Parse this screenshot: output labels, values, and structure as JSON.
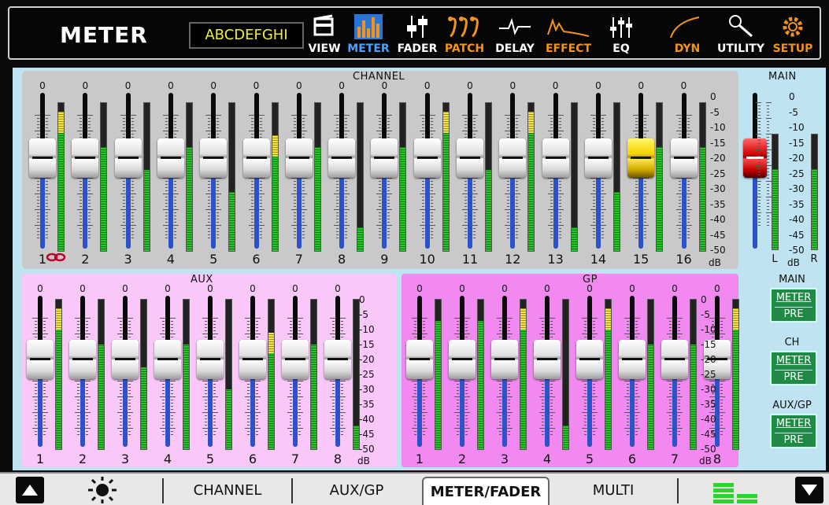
{
  "header": {
    "title": "METER",
    "scene_name": "ABCDEFGHI",
    "nav": [
      {
        "label": "VIEW",
        "icon": "view-icon",
        "color": "white",
        "active": false
      },
      {
        "label": "METER",
        "icon": "meter-icon",
        "color": "blue",
        "active": true
      },
      {
        "label": "FADER",
        "icon": "fader-icon",
        "color": "white",
        "active": false
      },
      {
        "label": "PATCH",
        "icon": "patch-icon",
        "color": "orange",
        "active": false
      },
      {
        "label": "DELAY",
        "icon": "delay-icon",
        "color": "white",
        "active": false
      },
      {
        "label": "EFFECT",
        "icon": "effect-icon",
        "color": "orange",
        "active": false
      },
      {
        "label": "EQ",
        "icon": "eq-icon",
        "color": "white",
        "active": false
      },
      {
        "label": "DYN",
        "icon": "dyn-icon",
        "color": "orange",
        "active": false
      },
      {
        "label": "UTILITY",
        "icon": "utility-icon",
        "color": "white",
        "active": false
      },
      {
        "label": "SETUP",
        "icon": "setup-icon",
        "color": "orange",
        "active": false
      }
    ]
  },
  "channel_section": {
    "title": "CHANNEL",
    "scale_unit": "dB",
    "scale": [
      "0",
      "-5",
      "-10",
      "-15",
      "-20",
      "-25",
      "-30",
      "-35",
      "-40",
      "-45",
      "-50"
    ],
    "strips": [
      {
        "number": "1",
        "gain": "0",
        "fader": 0.58,
        "meter": 0.94,
        "meter_peak": true,
        "knob": "white"
      },
      {
        "number": "2",
        "gain": "0",
        "fader": 0.58,
        "meter": 0.7,
        "meter_peak": false,
        "knob": "white"
      },
      {
        "number": "3",
        "gain": "0",
        "fader": 0.58,
        "meter": 0.55,
        "meter_peak": false,
        "knob": "white"
      },
      {
        "number": "4",
        "gain": "0",
        "fader": 0.58,
        "meter": 0.7,
        "meter_peak": false,
        "knob": "white"
      },
      {
        "number": "5",
        "gain": "0",
        "fader": 0.58,
        "meter": 0.4,
        "meter_peak": false,
        "knob": "white"
      },
      {
        "number": "6",
        "gain": "0",
        "fader": 0.58,
        "meter": 0.78,
        "meter_peak": true,
        "knob": "white"
      },
      {
        "number": "7",
        "gain": "0",
        "fader": 0.58,
        "meter": 0.7,
        "meter_peak": false,
        "knob": "white"
      },
      {
        "number": "8",
        "gain": "0",
        "fader": 0.58,
        "meter": 0.16,
        "meter_peak": false,
        "knob": "white"
      },
      {
        "number": "9",
        "gain": "0",
        "fader": 0.58,
        "meter": 0.7,
        "meter_peak": false,
        "knob": "white"
      },
      {
        "number": "10",
        "gain": "0",
        "fader": 0.58,
        "meter": 0.94,
        "meter_peak": true,
        "knob": "white"
      },
      {
        "number": "11",
        "gain": "0",
        "fader": 0.58,
        "meter": 0.55,
        "meter_peak": false,
        "knob": "white"
      },
      {
        "number": "12",
        "gain": "0",
        "fader": 0.58,
        "meter": 0.94,
        "meter_peak": true,
        "knob": "white"
      },
      {
        "number": "13",
        "gain": "0",
        "fader": 0.58,
        "meter": 0.16,
        "meter_peak": false,
        "knob": "white"
      },
      {
        "number": "14",
        "gain": "0",
        "fader": 0.58,
        "meter": 0.4,
        "meter_peak": false,
        "knob": "white"
      },
      {
        "number": "15",
        "gain": "0",
        "fader": 0.58,
        "meter": 0.7,
        "meter_peak": false,
        "knob": "yellow"
      },
      {
        "number": "16",
        "gain": "0",
        "fader": 0.58,
        "meter": 0.7,
        "meter_peak": false,
        "knob": "white"
      }
    ]
  },
  "main_section": {
    "title": "MAIN",
    "scale": [
      "0",
      "-5",
      "-10",
      "-15",
      "-20",
      "-25",
      "-30",
      "-35",
      "-40",
      "-45",
      "-50"
    ],
    "scale_unit": "dB",
    "fader": 0.58,
    "meter_l": 0.7,
    "meter_r": 0.7,
    "left_label": "L",
    "right_label": "R"
  },
  "aux_section": {
    "title": "AUX",
    "scale_unit": "dB",
    "scale": [
      "0",
      "-5",
      "-10",
      "-15",
      "-20",
      "-25",
      "-30",
      "-35",
      "-40",
      "-45",
      "-50"
    ],
    "strips": [
      {
        "number": "1",
        "gain": "0",
        "fader": 0.58,
        "meter": 0.94,
        "meter_peak": true
      },
      {
        "number": "2",
        "gain": "0",
        "fader": 0.58,
        "meter": 0.7,
        "meter_peak": false
      },
      {
        "number": "3",
        "gain": "0",
        "fader": 0.58,
        "meter": 0.55,
        "meter_peak": false
      },
      {
        "number": "4",
        "gain": "0",
        "fader": 0.58,
        "meter": 0.7,
        "meter_peak": false
      },
      {
        "number": "5",
        "gain": "0",
        "fader": 0.58,
        "meter": 0.4,
        "meter_peak": false
      },
      {
        "number": "6",
        "gain": "0",
        "fader": 0.58,
        "meter": 0.78,
        "meter_peak": true
      },
      {
        "number": "7",
        "gain": "0",
        "fader": 0.58,
        "meter": 0.7,
        "meter_peak": false
      },
      {
        "number": "8",
        "gain": "0",
        "fader": 0.58,
        "meter": 0.16,
        "meter_peak": false
      }
    ]
  },
  "gp_section": {
    "title": "GP",
    "scale_unit": "dB",
    "scale": [
      "0",
      "-5",
      "-10",
      "-15",
      "-20",
      "-25",
      "-30",
      "-35",
      "-40",
      "-45",
      "-50"
    ],
    "strips": [
      {
        "number": "1",
        "gain": "0",
        "fader": 0.58,
        "meter": 0.86,
        "meter_peak": false
      },
      {
        "number": "2",
        "gain": "0",
        "fader": 0.58,
        "meter": 0.86,
        "meter_peak": false
      },
      {
        "number": "3",
        "gain": "0",
        "fader": 0.58,
        "meter": 0.94,
        "meter_peak": true
      },
      {
        "number": "4",
        "gain": "0",
        "fader": 0.58,
        "meter": 0.16,
        "meter_peak": false
      },
      {
        "number": "5",
        "gain": "0",
        "fader": 0.58,
        "meter": 0.94,
        "meter_peak": true
      },
      {
        "number": "6",
        "gain": "0",
        "fader": 0.58,
        "meter": 0.7,
        "meter_peak": false
      },
      {
        "number": "7",
        "gain": "0",
        "fader": 0.58,
        "meter": 0.7,
        "meter_peak": false
      },
      {
        "number": "8",
        "gain": "0",
        "fader": 0.58,
        "meter": 0.94,
        "meter_peak": true
      }
    ]
  },
  "side_controls": [
    {
      "label": "MAIN",
      "button_top": "METER",
      "button_bottom": "PRE"
    },
    {
      "label": "CH",
      "button_top": "METER",
      "button_bottom": "PRE"
    },
    {
      "label": "AUX/GP",
      "button_top": "METER",
      "button_bottom": "PRE"
    }
  ],
  "bottom_tabs": [
    {
      "label": "CHANNEL",
      "active": false
    },
    {
      "label": "AUX/GP",
      "active": false
    },
    {
      "label": "METER/FADER",
      "active": true
    },
    {
      "label": "MULTI",
      "active": false
    }
  ],
  "colors": {
    "background": "#0b0b0b",
    "main_area": "#bfe3f0",
    "channel_panel": "#c9c9c9",
    "aux_panel": "#f9c8f9",
    "gp_panel": "#f189f1",
    "meter_green": "#24c524",
    "meter_yellow": "#f2e34a",
    "accent_orange": "#f39419",
    "accent_blue": "#4aa2ff",
    "button_green": "#1f8a46"
  }
}
